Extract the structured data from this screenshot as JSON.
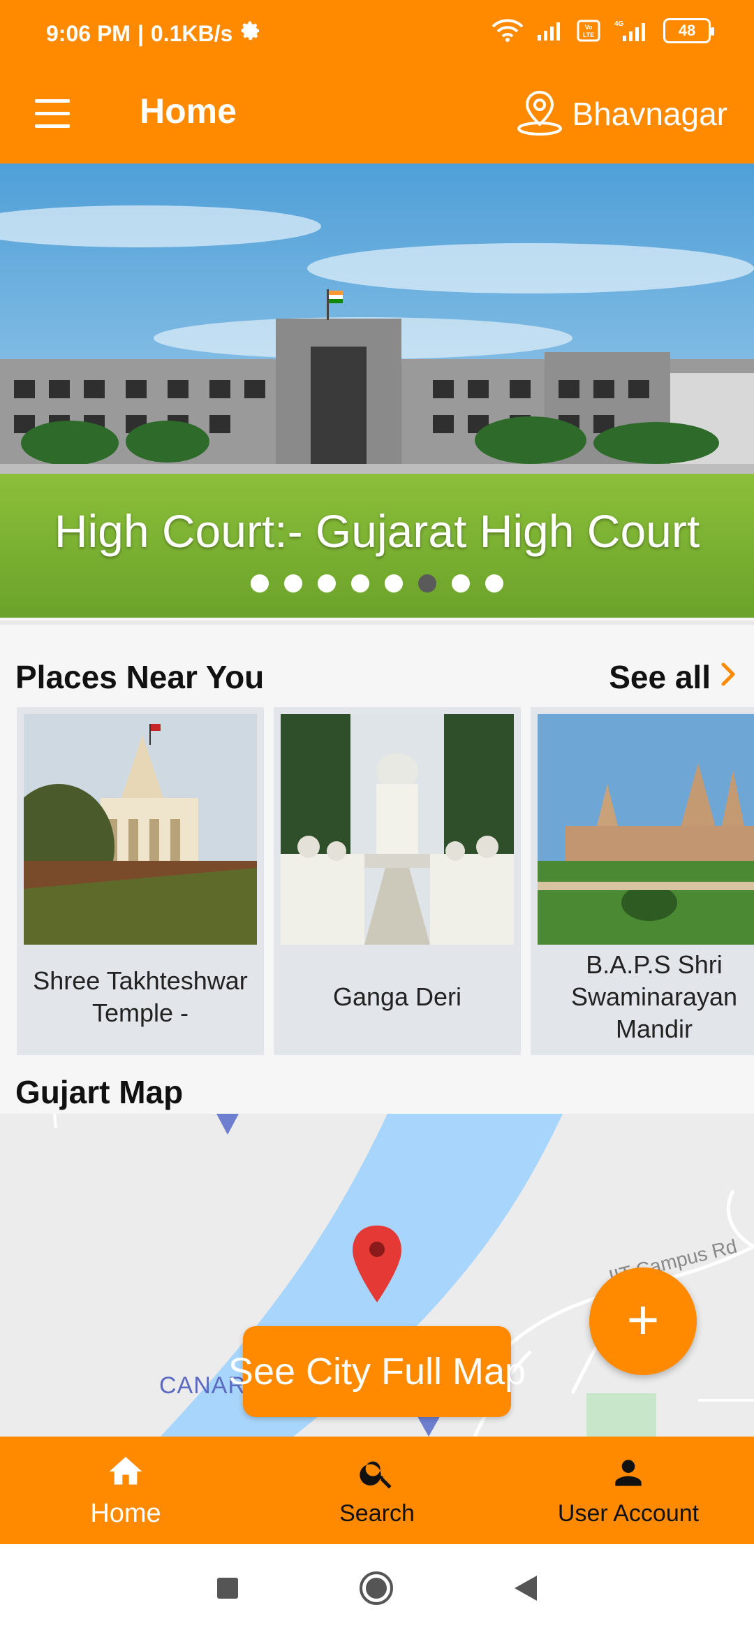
{
  "status_bar": {
    "time": "9:06 PM",
    "separator": "|",
    "net_speed": "0.1KB/s",
    "battery": "48",
    "icons": [
      "settings-gear-icon",
      "wifi-icon",
      "signal-icon",
      "volte-icon",
      "4g-signal-icon",
      "battery-icon"
    ]
  },
  "app_bar": {
    "menu_icon": "hamburger-menu-icon",
    "title": "Home",
    "location_icon": "location-pin-icon",
    "city": "Bhavnagar"
  },
  "banner": {
    "caption": "High Court:- Gujarat High Court",
    "slide_count": 8,
    "active_index": 5
  },
  "places": {
    "title": "Places Near You",
    "see_all": "See all",
    "items": [
      {
        "name": "Shree Takhteshwar Temple -"
      },
      {
        "name": "Ganga Deri"
      },
      {
        "name": "B.A.P.S Shri Swaminarayan Mandir"
      }
    ]
  },
  "map": {
    "title": "Gujart Map",
    "label_canal": "CANAR",
    "label_road": "IIT Campus Rd",
    "fab_label": "+",
    "full_map_button": "See City Full Map"
  },
  "bottom_nav": {
    "items": [
      {
        "label": "Home",
        "icon": "home-icon",
        "active": true
      },
      {
        "label": "Search",
        "icon": "search-icon",
        "active": false
      },
      {
        "label": "User Account",
        "icon": "person-icon",
        "active": false
      }
    ]
  },
  "colors": {
    "brand": "#ff8a00",
    "map_water": "#a8d5fb",
    "map_pin": "#e53935"
  }
}
